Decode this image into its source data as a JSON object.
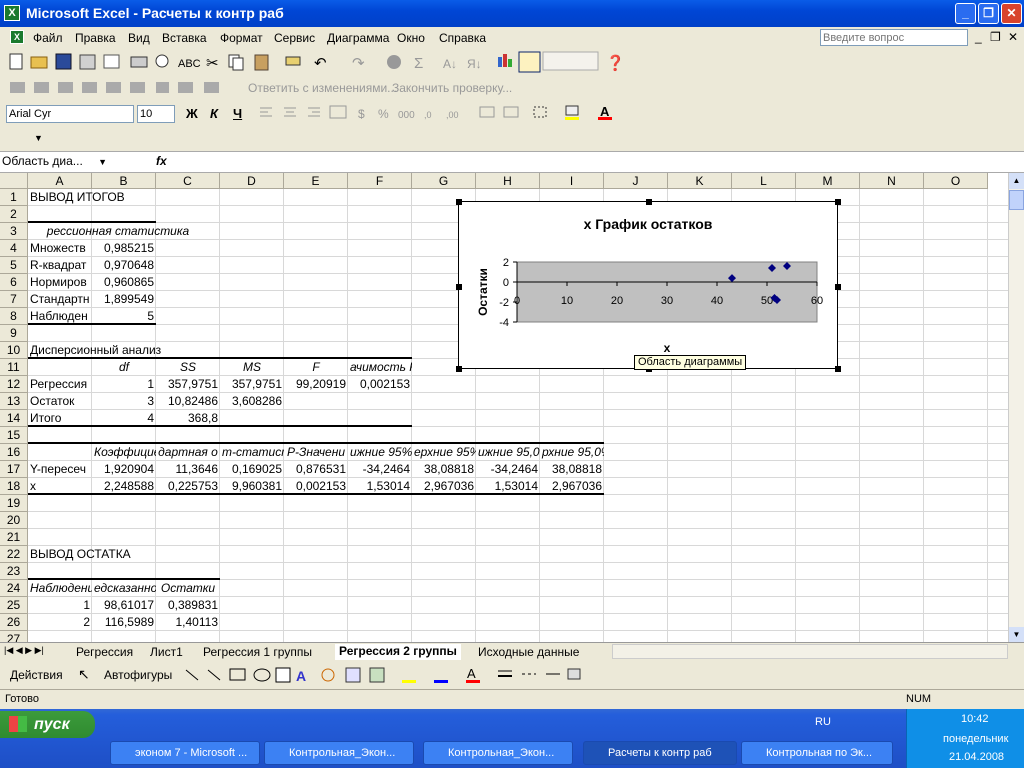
{
  "window": {
    "title": "Microsoft Excel - Расчеты к контр раб"
  },
  "menu": [
    "Файл",
    "Правка",
    "Вид",
    "Вставка",
    "Формат",
    "Сервис",
    "Диаграмма",
    "Окно",
    "Справка"
  ],
  "help_placeholder": "Введите вопрос",
  "toolbar_review": {
    "reply": "Ответить с изменениями...",
    "finish": "Закончить проверку..."
  },
  "format": {
    "font": "Arial Cyr",
    "size": "10"
  },
  "formula_bar": {
    "name_box": "Область диа...",
    "fx": "fx"
  },
  "columns": [
    "A",
    "B",
    "C",
    "D",
    "E",
    "F",
    "G",
    "H",
    "I",
    "J",
    "K",
    "L",
    "M",
    "N",
    "O"
  ],
  "rows": [
    "1",
    "2",
    "3",
    "4",
    "5",
    "6",
    "7",
    "8",
    "9",
    "10",
    "11",
    "12",
    "13",
    "14",
    "15",
    "16",
    "17",
    "18",
    "19",
    "20",
    "21",
    "22",
    "23",
    "24",
    "25",
    "26",
    "27"
  ],
  "cells": {
    "a1": "ВЫВОД ИТОГОВ",
    "a3": "рессионная статистика",
    "a4": "Множеств",
    "b4": "0,985215",
    "a5": "R-квадрат",
    "b5": "0,970648",
    "a6": "Нормиров",
    "b6": "0,960865",
    "a7": "Стандартн",
    "b7": "1,899549",
    "a8": "Наблюден",
    "b8": "5",
    "a10": "Дисперсионный анализ",
    "b11": "df",
    "c11": "SS",
    "d11": "MS",
    "e11": "F",
    "f11": "ачимость F",
    "a12": "Регрессия",
    "b12": "1",
    "c12": "357,9751",
    "d12": "357,9751",
    "e12": "99,20919",
    "f12": "0,002153",
    "a13": "Остаток",
    "b13": "3",
    "c13": "10,82486",
    "d13": "3,608286",
    "a14": "Итого",
    "b14": "4",
    "c14": "368,8",
    "b16": "Коэффициен",
    "c16": "дартная о",
    "d16": "т-статисти",
    "e16": "Р-Значени",
    "f16": "ижние 95%",
    "g16": "ерхние 95%",
    "h16": "ижние 95,0%",
    "i16": "рхние 95,0%",
    "a17": "Y-пересеч",
    "b17": "1,920904",
    "c17": "11,3646",
    "d17": "0,169025",
    "e17": "0,876531",
    "f17": "-34,2464",
    "g17": "38,08818",
    "h17": "-34,2464",
    "i17": "38,08818",
    "a18": "x",
    "b18": "2,248588",
    "c18": "0,225753",
    "d18": "9,960381",
    "e18": "0,002153",
    "f18": "1,53014",
    "g18": "2,967036",
    "h18": "1,53014",
    "i18": "2,967036",
    "a22": "ВЫВОД ОСТАТКА",
    "a24": "Наблюдение",
    "b24": "едсказанно",
    "c24": "Остатки",
    "a25": "1",
    "b25": "98,61017",
    "c25": "0,389831",
    "a26": "2",
    "b26": "116,5989",
    "c26": "1,40113"
  },
  "chart_data": {
    "type": "scatter",
    "title": "x График остатков",
    "xlabel": "x",
    "ylabel": "Остатки",
    "xlim": [
      0,
      60
    ],
    "ylim": [
      -4,
      2
    ],
    "xticks": [
      "0",
      "10",
      "20",
      "30",
      "40",
      "50",
      "60"
    ],
    "yticks": [
      "2",
      "0",
      "-2",
      "-4"
    ],
    "points": [
      [
        43,
        0.39
      ],
      [
        51,
        1.4
      ],
      [
        51.5,
        -1.6
      ],
      [
        52,
        -1.8
      ],
      [
        54,
        1.6
      ]
    ],
    "plot_area_color": "#c0c0c0",
    "marker_color": "#000080"
  },
  "tooltip": "Область диаграммы",
  "sheets": [
    "Регрессия",
    "Лист1",
    "Регрессия 1 группы",
    "Регрессия 2 группы",
    "Исходные данные"
  ],
  "active_sheet": "Регрессия 2 группы",
  "drawing": {
    "actions": "Действия",
    "autoshapes": "Автофигуры"
  },
  "status": {
    "left": "Готово",
    "num": "NUM"
  },
  "taskbar": {
    "start": "пуск",
    "lang": "RU",
    "time": "10:42",
    "day": "понедельник",
    "date": "21.04.2008",
    "tasks": [
      "эконом 7 - Microsoft ...",
      "Контрольная_Экон...",
      "Контрольная_Экон...",
      "Расчеты к контр раб",
      "Контрольная по Эк..."
    ]
  }
}
